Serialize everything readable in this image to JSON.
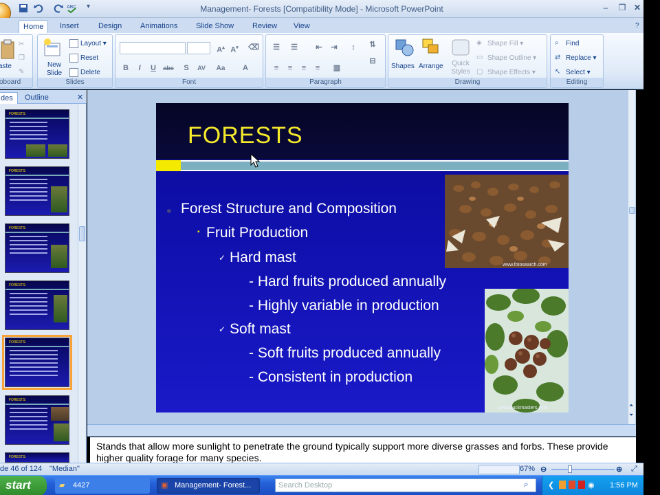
{
  "window": {
    "title": "Management- Forests [Compatibility Mode] - Microsoft PowerPoint"
  },
  "ribbon": {
    "tabs": [
      "Home",
      "Insert",
      "Design",
      "Animations",
      "Slide Show",
      "Review",
      "View"
    ],
    "active_tab": "Home",
    "groups": {
      "clipboard": {
        "label": "oboard",
        "paste": "aste"
      },
      "slides": {
        "label": "Slides",
        "new_slide": "New Slide",
        "layout": "Layout",
        "reset": "Reset",
        "delete": "Delete"
      },
      "font": {
        "label": "Font"
      },
      "paragraph": {
        "label": "Paragraph"
      },
      "drawing": {
        "label": "Drawing",
        "shapes": "Shapes",
        "arrange": "Arrange",
        "quick_styles": "Quick Styles",
        "shape_fill": "Shape Fill",
        "shape_outline": "Shape Outline",
        "shape_effects": "Shape Effects"
      },
      "editing": {
        "label": "Editing",
        "find": "Find",
        "replace": "Replace",
        "select": "Select"
      }
    }
  },
  "panel": {
    "tabs": [
      "des",
      "Outline"
    ],
    "thumbnail_title": "FORESTS:"
  },
  "slide": {
    "title": "FORESTS",
    "bullets": [
      {
        "level": 1,
        "text": "Forest Structure and Composition"
      },
      {
        "level": 2,
        "text": "Fruit Production"
      },
      {
        "level": 3,
        "text": "Hard mast"
      },
      {
        "level": 4,
        "text": "- Hard fruits produced annually"
      },
      {
        "level": 4,
        "text": "- Highly variable in production"
      },
      {
        "level": 3,
        "text": "Soft mast"
      },
      {
        "level": 4,
        "text": "- Soft fruits produced annually"
      },
      {
        "level": 4,
        "text": "- Consistent in production"
      }
    ],
    "photo_credit_1": "www.fotosearch.com",
    "photo_credit_2": "www.buckmasters.com"
  },
  "notes": {
    "text": "Stands that allow more sunlight to penetrate the ground typically support more diverse grasses and forbs.  These provide higher quality forage for many species."
  },
  "status": {
    "slide_counter": "de 46 of 124",
    "theme": "\"Median\"",
    "zoom": "67%"
  },
  "taskbar": {
    "start": "start",
    "item1": "4427",
    "item2": "Management- Forest...",
    "search_placeholder": "Search Desktop",
    "clock": "1:56 PM"
  },
  "colors": {
    "slide_bg": "#1414b8",
    "title_yellow": "#f6ea2b",
    "accent_teal": "#7cb0c0"
  }
}
